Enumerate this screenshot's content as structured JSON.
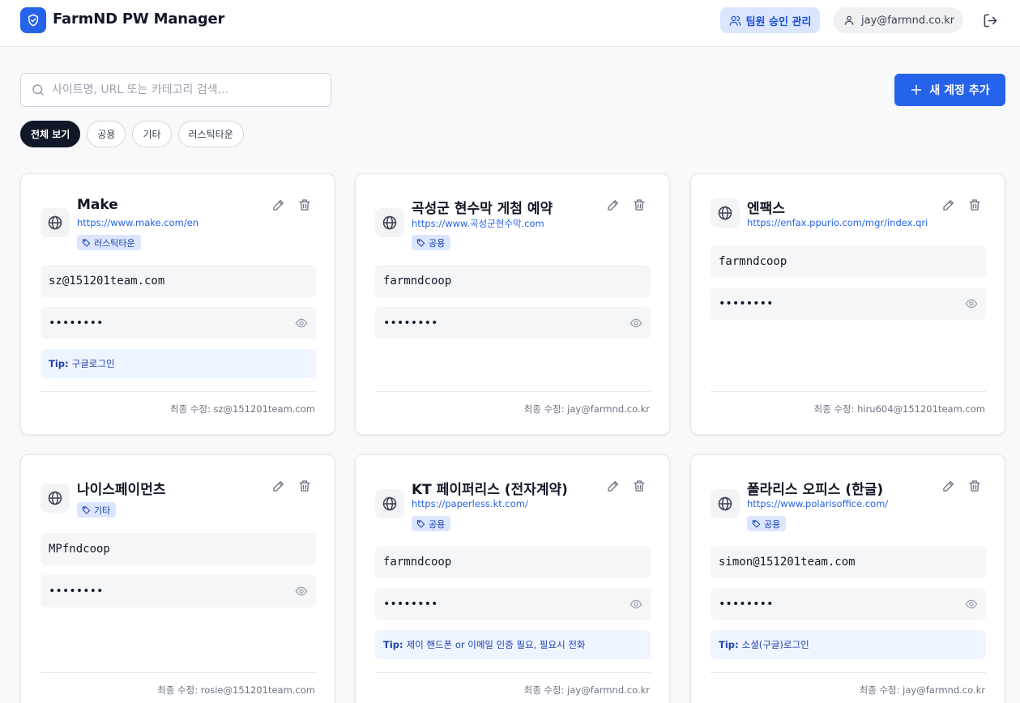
{
  "app": {
    "title": "FarmND PW Manager"
  },
  "header": {
    "team_button": "팀원 승인 관리",
    "user_email": "jay@farmnd.co.kr"
  },
  "search": {
    "placeholder": "사이트명, URL 또는 카테고리 검색..."
  },
  "add_button": "새 계정 추가",
  "filters": [
    "전체 보기",
    "공용",
    "기타",
    "러스틱타운"
  ],
  "active_filter": "전체 보기",
  "colors": {
    "accent": "#2563eb",
    "tag_bg": "#dbe6fe",
    "tip_bg": "#eff5ff"
  },
  "modified_prefix": "최종 수정:",
  "tip_prefix": "Tip:",
  "cards": [
    {
      "name": "Make",
      "url": "https://www.make.com/en",
      "tag": "러스틱타운",
      "username": "sz@151201team.com",
      "password": "••••••••",
      "tip": "구글로그인",
      "modified_by": "sz@151201team.com"
    },
    {
      "name": "곡성군 현수막 게첨 예약",
      "url": "https://www.곡성군현수막.com",
      "tag": "공용",
      "username": "farmndcoop",
      "password": "••••••••",
      "tip": "",
      "modified_by": "jay@farmnd.co.kr"
    },
    {
      "name": "엔팩스",
      "url": "https://enfax.ppurio.com/mgr/index.qri",
      "tag": "",
      "username": "farmndcoop",
      "password": "••••••••",
      "tip": "",
      "modified_by": "hiru604@151201team.com"
    },
    {
      "name": "나이스페이먼츠",
      "url": "",
      "tag": "기타",
      "username": "MPfndcoop",
      "password": "••••••••",
      "tip": "",
      "modified_by": "rosie@151201team.com"
    },
    {
      "name": "KT 페이퍼리스 (전자계약)",
      "url": "https://paperless.kt.com/",
      "tag": "공용",
      "username": "farmndcoop",
      "password": "••••••••",
      "tip": "제이 핸드폰 or 이메일 인증 필요, 필요시 전화",
      "modified_by": "jay@farmnd.co.kr"
    },
    {
      "name": "폴라리스 오피스 (한글)",
      "url": "https://www.polarisoffice.com/",
      "tag": "공용",
      "username": "simon@151201team.com",
      "password": "••••••••",
      "tip": "소셜(구글)로그인",
      "modified_by": "jay@farmnd.co.kr"
    }
  ]
}
